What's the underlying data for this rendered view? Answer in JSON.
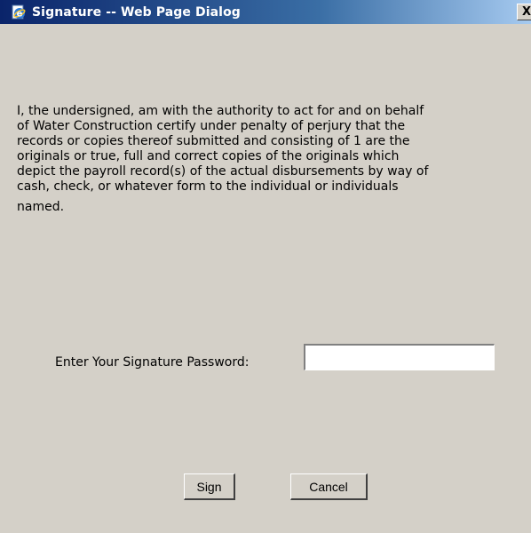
{
  "window": {
    "title": "Signature -- Web Page Dialog",
    "icon": "ie-page-icon",
    "close_label": "X"
  },
  "dialog": {
    "statement_lines": [
      "I, the undersigned, am with the authority to act for and on behalf",
      "of Water Construction  certify under penalty of perjury that the",
      "records or copies thereof submitted and consisting of 1 are the",
      "originals or true, full and correct copies of the originals which",
      "depict the payroll record(s) of the actual disbursements by way of",
      "cash, check, or whatever form to the individual or individuals",
      "named."
    ],
    "password_label": "Enter Your Signature Password:",
    "password_value": "",
    "sign_label": "Sign",
    "cancel_label": "Cancel"
  }
}
